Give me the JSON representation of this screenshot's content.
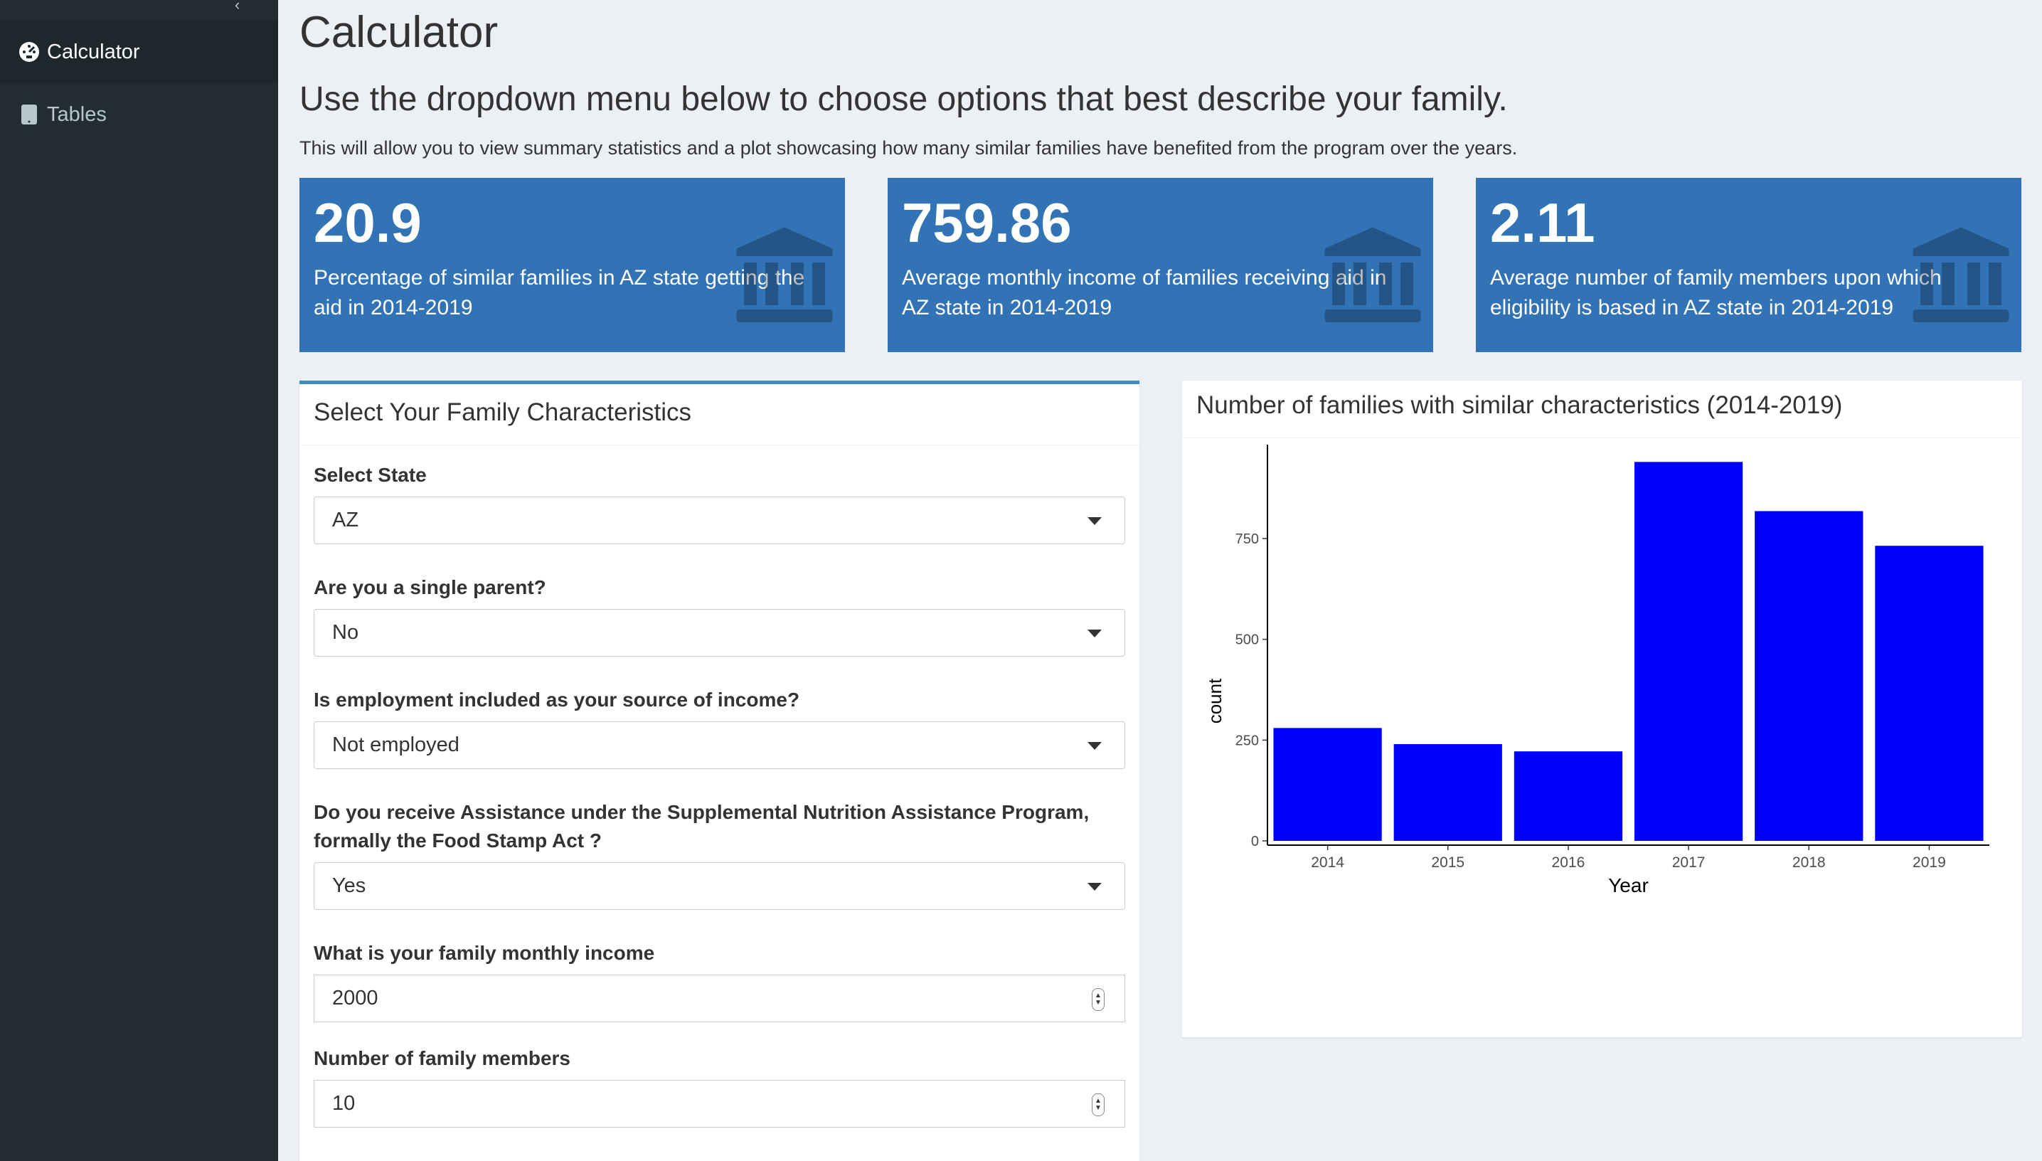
{
  "sidebar": {
    "items": [
      {
        "label": "Calculator",
        "icon": "dashboard-icon",
        "active": true
      },
      {
        "label": "Tables",
        "icon": "tablet-icon",
        "active": false
      }
    ]
  },
  "page": {
    "title": "Calculator",
    "subtitle": "Use the dropdown menu below to choose options that best describe your family.",
    "description": "This will allow you to view summary statistics and a plot showcasing how many similar families have benefited from the program over the years."
  },
  "value_boxes": [
    {
      "value": "20.9",
      "text": "Percentage of similar families in AZ state getting the aid in 2014-2019",
      "icon": "bank-icon"
    },
    {
      "value": "759.86",
      "text": "Average monthly income of families receiving aid in AZ state in 2014-2019",
      "icon": "bank-icon"
    },
    {
      "value": "2.11",
      "text": "Average number of family members upon which eligibility is based in AZ state in 2014-2019",
      "icon": "bank-icon"
    }
  ],
  "colors": {
    "sidebar_bg": "#222d32",
    "value_box_bg": "#3173b4",
    "bar_color": "#0000ff",
    "box_accent": "#3c8dbc"
  },
  "form": {
    "title": "Select Your Family Characteristics",
    "fields": [
      {
        "label": "Select State",
        "value": "AZ",
        "type": "select"
      },
      {
        "label": "Are you a single parent?",
        "value": "No",
        "type": "select"
      },
      {
        "label": "Is employment included as your source of income?",
        "value": "Not employed",
        "type": "select"
      },
      {
        "label": "Do you receive Assistance under the Supplemental Nutrition Assistance Program, formally the Food Stamp Act ?",
        "value": "Yes",
        "type": "select"
      },
      {
        "label": "What is your family monthly income",
        "value": "2000",
        "type": "number"
      },
      {
        "label": "Number of family members",
        "value": "10",
        "type": "number"
      }
    ]
  },
  "chart_box": {
    "title": "Number of families with similar characteristics (2014-2019)"
  },
  "chart_data": {
    "type": "bar",
    "categories": [
      "2014",
      "2015",
      "2016",
      "2017",
      "2018",
      "2019"
    ],
    "values": [
      280,
      240,
      222,
      940,
      818,
      732
    ],
    "xlabel": "Year",
    "ylabel": "count",
    "yticks": [
      0,
      250,
      500,
      750
    ],
    "ylim": [
      0,
      990
    ],
    "grid": false
  }
}
